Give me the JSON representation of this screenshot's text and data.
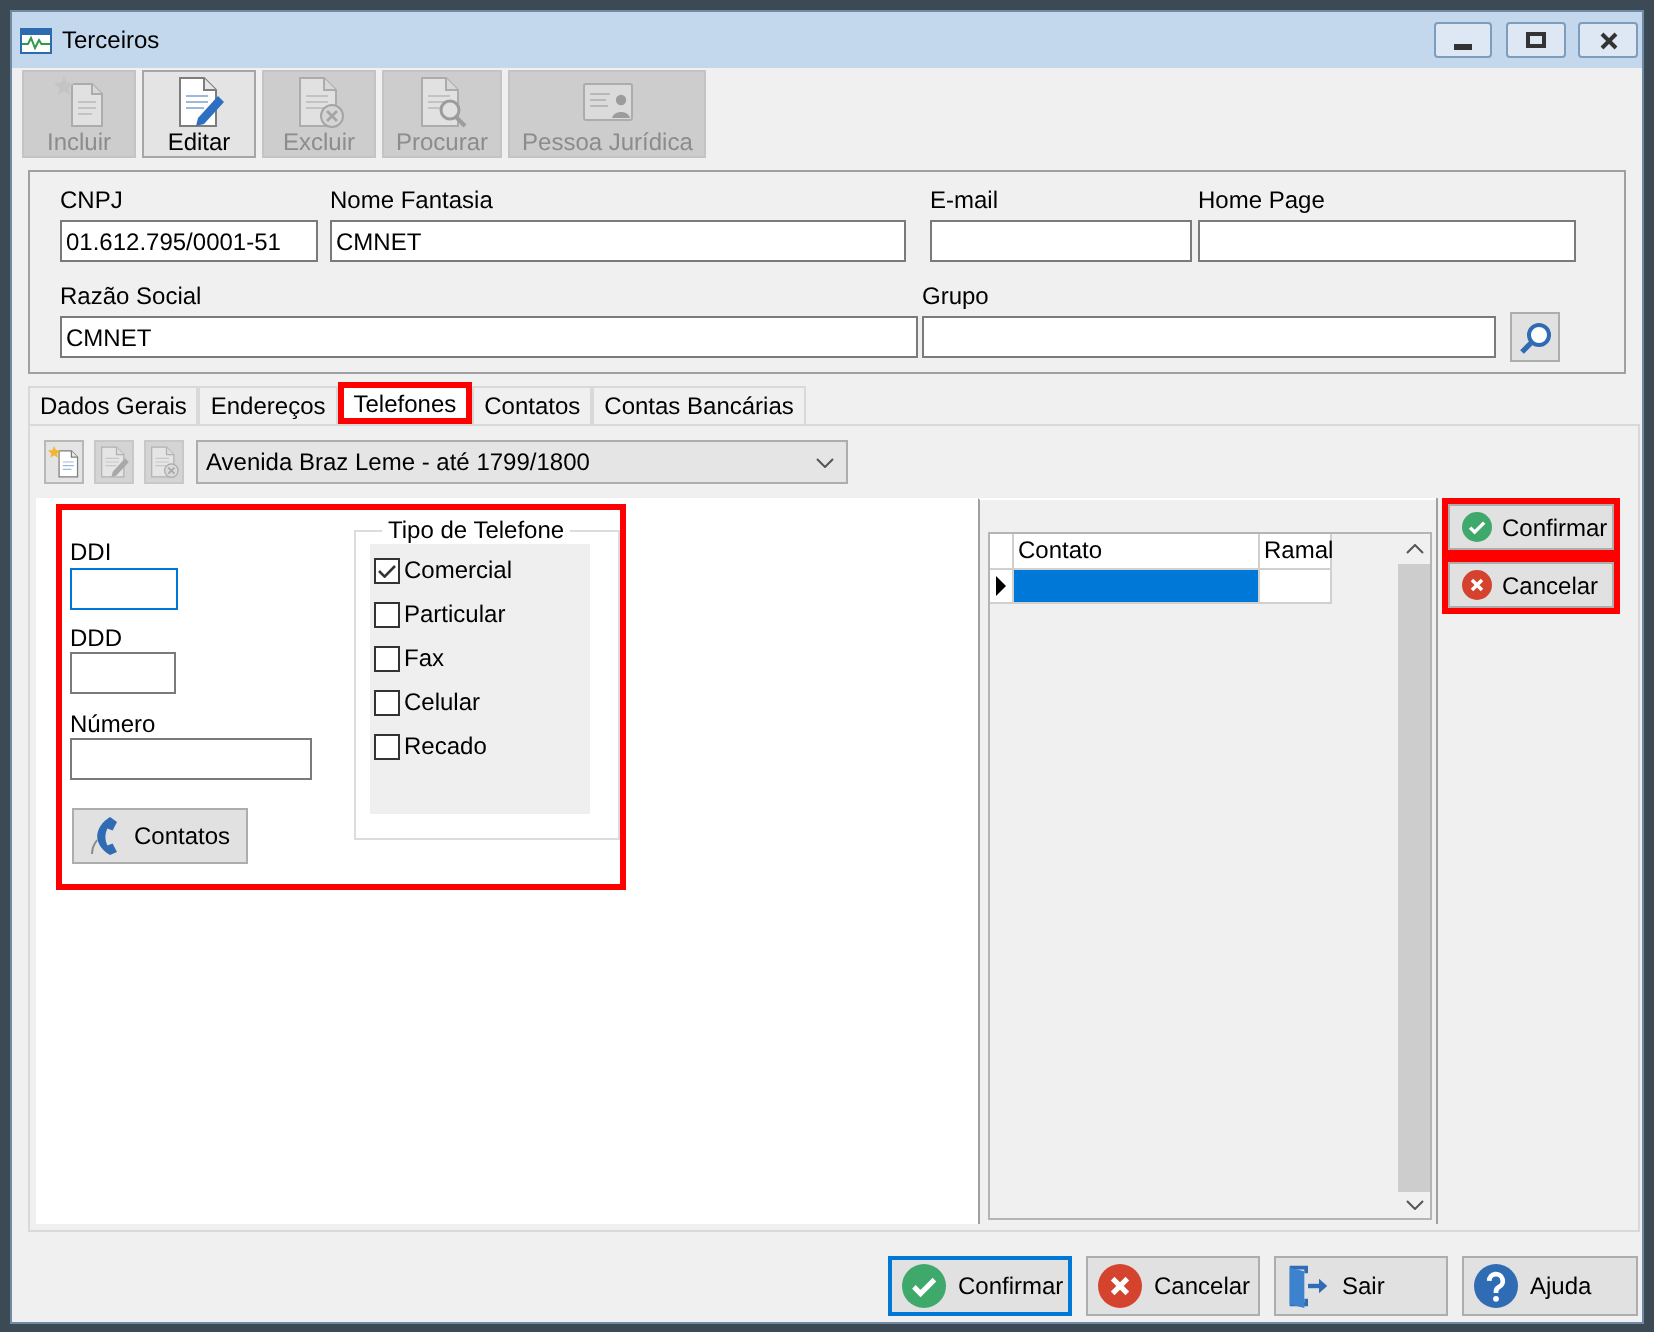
{
  "window": {
    "title": "Terceiros"
  },
  "toolbar": [
    {
      "label": "Incluir",
      "kind": "new",
      "disabled": true
    },
    {
      "label": "Editar",
      "kind": "edit",
      "disabled": false
    },
    {
      "label": "Excluir",
      "kind": "delete",
      "disabled": true
    },
    {
      "label": "Procurar",
      "kind": "search",
      "disabled": true
    },
    {
      "label": "Pessoa Jurídica",
      "kind": "card",
      "disabled": true
    }
  ],
  "header_fields": [
    [
      {
        "label": "CNPJ",
        "value": "01.612.795/0001-51"
      },
      {
        "label": "Nome Fantasia",
        "value": "CMNET"
      },
      {
        "label": "E-mail"
      },
      {
        "label": "Home Page"
      }
    ],
    [
      {
        "label": "Razão Social",
        "value": "CMNET"
      },
      {
        "label": "Grupo"
      }
    ]
  ],
  "tabs": [
    {
      "label": "Dados Gerais",
      "selected": false,
      "highlighted": false
    },
    {
      "label": "Endereços",
      "selected": false,
      "highlighted": false
    },
    {
      "label": "Telefones",
      "selected": true,
      "highlighted": true
    },
    {
      "label": "Contatos",
      "selected": false,
      "highlighted": false
    },
    {
      "label": "Contas Bancárias",
      "selected": false,
      "highlighted": false
    }
  ],
  "address_toolbar": {
    "buttons": [
      {
        "kind": "new",
        "disabled": false
      },
      {
        "kind": "edit",
        "disabled": true
      },
      {
        "kind": "delete",
        "disabled": true
      }
    ],
    "address": {
      "value": "Avenida Braz Leme - até 1799/1800"
    }
  },
  "phone_form": {
    "highlighted": true,
    "fields": [
      {
        "label": "DDI",
        "focused": true
      },
      {
        "label": "DDD",
        "focused": false
      },
      {
        "label": "Número",
        "focused": false
      }
    ],
    "contacts_button": {
      "label": "Contatos"
    },
    "phone_type": {
      "title": "Tipo de Telefone",
      "options": [
        {
          "label": "Comercial",
          "checked": true
        },
        {
          "label": "Particular",
          "checked": false
        },
        {
          "label": "Fax",
          "checked": false
        },
        {
          "label": "Celular",
          "checked": false
        },
        {
          "label": "Recado",
          "checked": false
        }
      ]
    }
  },
  "contacts_grid": {
    "columns": [
      "Contato",
      "Ramal"
    ],
    "rows": [
      {
        "selected": true
      }
    ]
  },
  "side_buttons": [
    {
      "label": "Confirmar",
      "kind": "confirm",
      "highlighted": true
    },
    {
      "label": "Cancelar",
      "kind": "cancel",
      "highlighted": true
    }
  ],
  "footer_buttons": [
    {
      "label": "Confirmar",
      "kind": "confirm",
      "focused": true
    },
    {
      "label": "Cancelar",
      "kind": "cancel",
      "focused": false
    },
    {
      "label": "Sair",
      "kind": "exit",
      "focused": false
    },
    {
      "label": "Ajuda",
      "kind": "help",
      "focused": false
    }
  ]
}
